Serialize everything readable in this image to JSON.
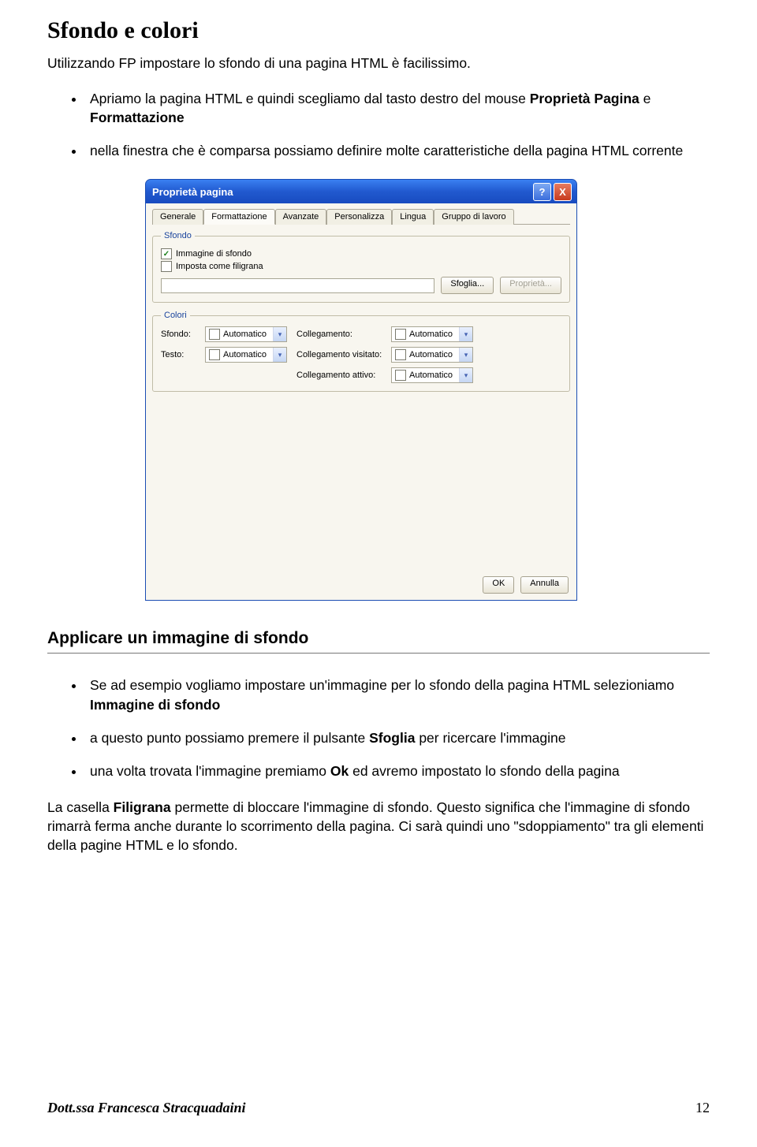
{
  "title": "Sfondo e colori",
  "intro": "Utilizzando FP impostare lo sfondo di una pagina HTML è facilissimo.",
  "top_bullets": [
    {
      "pre": "Apriamo la pagina HTML e quindi scegliamo dal tasto destro del mouse ",
      "b1": "Proprietà Pagina",
      "mid": " e ",
      "b2": "Formattazione",
      "post": ""
    },
    {
      "pre": "nella finestra che è comparsa possiamo definire molte caratteristiche della pagina HTML corrente",
      "b1": "",
      "mid": "",
      "b2": "",
      "post": ""
    }
  ],
  "dialog": {
    "title": "Proprietà pagina",
    "help": "?",
    "close": "X",
    "tabs": [
      "Generale",
      "Formattazione",
      "Avanzate",
      "Personalizza",
      "Lingua",
      "Gruppo di lavoro"
    ],
    "active_tab": 1,
    "bg_legend": "Sfondo",
    "chk1_checked": true,
    "chk1_label": "Immagine di sfondo",
    "chk2_checked": false,
    "chk2_label": "Imposta come filigrana",
    "browse": "Sfoglia...",
    "props": "Proprietà...",
    "colors_legend": "Colori",
    "labels": {
      "sfondo": "Sfondo:",
      "testo": "Testo:",
      "coll": "Collegamento:",
      "coll_vis": "Collegamento visitato:",
      "coll_att": "Collegamento attivo:"
    },
    "combo_text": "Automatico",
    "ok": "OK",
    "cancel": "Annulla"
  },
  "subheading": "Applicare un immagine di sfondo",
  "mid_bullets": [
    {
      "pre": "Se ad esempio vogliamo impostare un'immagine per lo sfondo della pagina HTML selezioniamo ",
      "b": "Immagine di sfondo",
      "post": ""
    },
    {
      "pre": "a questo punto possiamo premere il pulsante ",
      "b": "Sfoglia",
      "post": "  per ricercare l'immagine"
    },
    {
      "pre": "una volta trovata l'immagine premiamo ",
      "b": "Ok",
      "post": " ed avremo impostato lo sfondo della pagina"
    }
  ],
  "para_parts": {
    "p1a": "La casella ",
    "p1b": "Filigrana",
    "p1c": " permette di bloccare l'immagine di sfondo. Questo significa che l'immagine di sfondo rimarrà ferma anche durante lo scorrimento della pagina. Ci sarà quindi uno \"sdoppiamento\" tra gli elementi della pagine HTML e lo sfondo."
  },
  "footer_left": "Dott.ssa Francesca Stracquadaini",
  "footer_right": "12"
}
